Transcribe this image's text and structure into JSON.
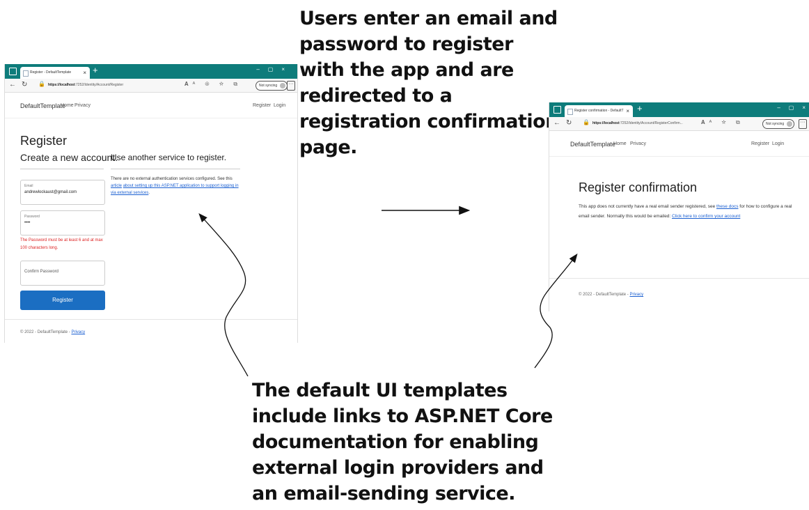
{
  "callouts": {
    "top": "Users enter an email and password to register with the app and are redirected to a registration confirmation page.",
    "bottom": "The default UI templates include links to ASP.NET Core documentation for enabling external login providers and an email-sending service."
  },
  "register_window": {
    "tab_title": "Register - DefaultTemplate",
    "url_host": "https://localhost",
    "url_path": ":7252/Identity/Account/Register",
    "sync_label": "Not syncing",
    "brand": "DefaultTemplate",
    "nav": {
      "home": "Home",
      "privacy": "Privacy",
      "register": "Register",
      "login": "Login"
    },
    "heading": "Register",
    "subheading": "Create a new account.",
    "external_heading": "Use another service to register.",
    "external_text": "There are no external authentication services configured. See this",
    "external_link_word": "article",
    "external_link_text": "about setting up this ASP.NET application to support logging in via external services",
    "external_text_end": ".",
    "email_label": "Email",
    "email_value": "andrewlockaust@gmail.com",
    "password_label": "Password",
    "password_value": "••••",
    "password_error": "The Password must be at least 6 and at max 100 characters long.",
    "confirm_password_label": "Confirm Password",
    "register_button": "Register",
    "footer_text": "© 2022 - DefaultTemplate -",
    "footer_link": "Privacy"
  },
  "confirm_window": {
    "tab_title": "Register confirmation - DefaultT",
    "url_host": "https://localhost",
    "url_path": ":7252/Identity/Account/RegisterConfirm...",
    "sync_label": "Not syncing",
    "brand": "DefaultTemplate",
    "nav": {
      "home": "Home",
      "privacy": "Privacy",
      "register": "Register",
      "login": "Login"
    },
    "heading": "Register confirmation",
    "text1": "This app does not currently have a real email sender registered, see",
    "docs_link": "these docs",
    "text2": "for how to configure a real email sender. Normally this would be emailed:",
    "confirm_link": "Click here to confirm your account",
    "footer_text": "© 2022 - DefaultTemplate -",
    "footer_link": "Privacy"
  },
  "icons": [
    "window-icon",
    "favicon",
    "close-tab-icon",
    "new-tab-icon",
    "back-icon",
    "refresh-icon",
    "lock-icon",
    "read-aloud-icon",
    "favorites-icon",
    "avatar-icon",
    "more-icon"
  ],
  "colors": {
    "titlebar": "#0e7c7b",
    "button": "#1b6ec2",
    "error": "#dd2222",
    "link": "#1a5fd1"
  }
}
